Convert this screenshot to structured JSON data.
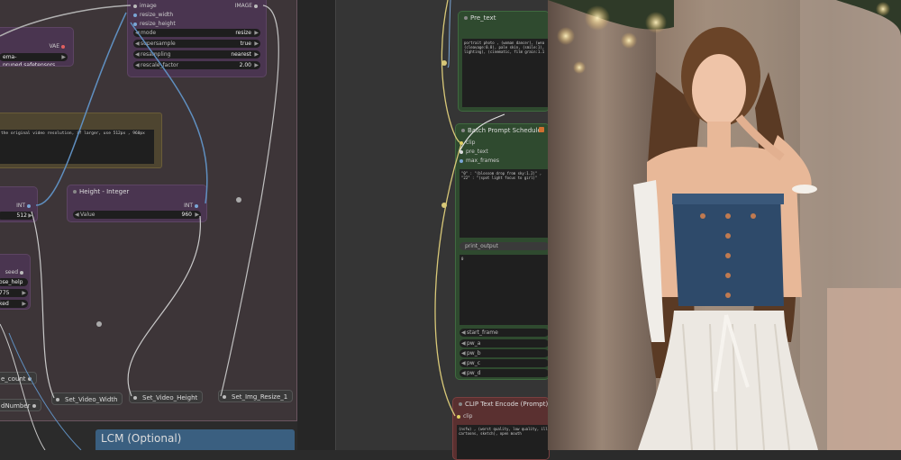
{
  "left_canvas": {
    "image_resize_node": {
      "inputs": [
        "image",
        "resize_width",
        "resize_height"
      ],
      "output": "IMAGE",
      "widgets": [
        {
          "label": "mode",
          "value": "resize"
        },
        {
          "label": "supersample",
          "value": "true"
        },
        {
          "label": "resampling",
          "value": "nearest"
        },
        {
          "label": "rescale_factor",
          "value": "2.00"
        }
      ]
    },
    "vae_node": {
      "output": "VAE",
      "widget_value": "ema-pruned.safetensors"
    },
    "note_node": {
      "text": "the original video resolution, if larger, use 512px , 960px"
    },
    "width_node": {
      "output": "INT",
      "value": "512"
    },
    "height_node": {
      "title": "Height - Integer",
      "output": "INT",
      "widget_label": "Value",
      "widget_value": "960"
    },
    "seed_node": {
      "output_seed": "seed",
      "output_help": "ose_help",
      "value1": "775",
      "value2": "ked"
    },
    "set_nodes": [
      "Set_Video_Width",
      "Set_Video_Height",
      "Set_Img_Resize_1"
    ],
    "partial_pills": [
      "e_count",
      "dNumber"
    ],
    "lcm_group": "LCM (Optional)"
  },
  "right_canvas": {
    "pre_text_node": {
      "title": "Pre_text",
      "text": "portrait photo , (woman dancer), (wea\n(cleavage:0.8), pale skin, (smile:1),\nlighting), (cinematic, film grain:1.1"
    },
    "batch_prompt_node": {
      "title": "Batch Prompt Schedule",
      "inputs": [
        "clip",
        "pre_text",
        "max_frames"
      ],
      "text": "\"0\" : \"(blossom drop from sky:1.2)\" ,\n\"22\" : \"(spot light focus to girl)\"",
      "output_pill": "print_output",
      "lower_text": "0",
      "widgets": [
        "start_frame",
        "pw_a",
        "pw_b",
        "pw_c",
        "pw_d"
      ]
    },
    "clip_encode_node": {
      "title": "CLIP Text Encode (Prompt)",
      "input": "clip",
      "text": "(nsfw) , (worst quality, low quality, ill\ncartoons, sketch), open mouth"
    }
  },
  "colors": {
    "purple_node": "#4a3550",
    "green_node": "#2f4a2f",
    "canvas": "#2b2b2b",
    "group_frame": "#3d3538"
  }
}
